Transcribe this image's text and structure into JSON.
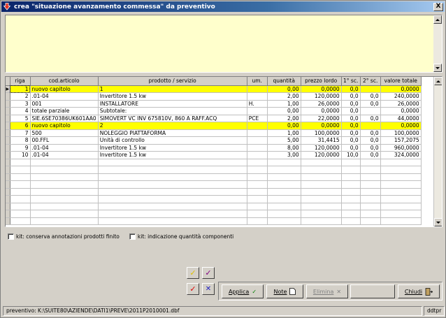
{
  "window": {
    "title": "crea \"situazione avanzamento commessa\" da preventivo",
    "close_label": "X"
  },
  "grid": {
    "columns": [
      "riga",
      "cod.articolo",
      "prodotto / servizio",
      "um.",
      "quantità",
      "prezzo lordo",
      "1° sc.",
      "2° sc.",
      "valore totale"
    ],
    "rows": [
      {
        "riga": "1",
        "cod": "nuovo capitolo",
        "prod": "1",
        "um": "",
        "qta": "0,00",
        "prezzo": "0,0000",
        "sc1": "0,0",
        "sc2": "",
        "tot": "0,0000",
        "highlight": true,
        "current": true
      },
      {
        "riga": "2",
        "cod": ".01-04",
        "prod": "Invertitore 1.5 kw",
        "um": "",
        "qta": "2,00",
        "prezzo": "120,0000",
        "sc1": "0,0",
        "sc2": "0,0",
        "tot": "240,0000",
        "highlight": false
      },
      {
        "riga": "3",
        "cod": "001",
        "prod": "INSTALLATORE",
        "um": "H.",
        "qta": "1,00",
        "prezzo": "26,0000",
        "sc1": "0,0",
        "sc2": "0,0",
        "tot": "26,0000",
        "highlight": false
      },
      {
        "riga": "4",
        "cod": "totale parziale",
        "prod": "Subtotale:",
        "um": "",
        "qta": "0,00",
        "prezzo": "0,0000",
        "sc1": "0,0",
        "sc2": "",
        "tot": "0,0000",
        "highlight": false
      },
      {
        "riga": "5",
        "cod": "SIE.6SE70386UK601AA0",
        "prod": "SIMOVERT VC INV 675810V, 860 A  RAFF.ACQ",
        "um": "PCE",
        "qta": "2,00",
        "prezzo": "22,0000",
        "sc1": "0,0",
        "sc2": "0,0",
        "tot": "44,0000",
        "highlight": false
      },
      {
        "riga": "6",
        "cod": "nuovo capitolo",
        "prod": "2",
        "um": "",
        "qta": "0,00",
        "prezzo": "0,0000",
        "sc1": "0,0",
        "sc2": "",
        "tot": "0,0000",
        "highlight": true
      },
      {
        "riga": "7",
        "cod": "500",
        "prod": "NOLEGGIO PIATTAFORMA",
        "um": "",
        "qta": "1,00",
        "prezzo": "100,0000",
        "sc1": "0,0",
        "sc2": "0,0",
        "tot": "100,0000",
        "highlight": false
      },
      {
        "riga": "8",
        "cod": "00.FFL",
        "prod": "Unità di controllo",
        "um": "",
        "qta": "5,00",
        "prezzo": "31,4415",
        "sc1": "0,0",
        "sc2": "0,0",
        "tot": "157,2075",
        "highlight": false
      },
      {
        "riga": "9",
        "cod": ".01-04",
        "prod": "Invertitore 1.5 kw",
        "um": "",
        "qta": "8,00",
        "prezzo": "120,0000",
        "sc1": "0,0",
        "sc2": "0,0",
        "tot": "960,0000",
        "highlight": false
      },
      {
        "riga": "10",
        "cod": ".01-04",
        "prod": "Invertitore 1.5 kw",
        "um": "",
        "qta": "3,00",
        "prezzo": "120,0000",
        "sc1": "10,0",
        "sc2": "0,0",
        "tot": "324,0000",
        "highlight": false
      }
    ],
    "empty_rows": 9
  },
  "options": {
    "kit_annotazioni": "kit: conserva annotazioni prodotti finito",
    "kit_quantita": "kit: indicazione quantità componenti"
  },
  "buttons": {
    "applica": "Applica",
    "note": "Note",
    "elimina": "Elimina",
    "chiudi": "Chiudi"
  },
  "status": {
    "path": "preventivo: K:\\SUITE80\\AZIENDE\\DATI1\\PREVE\\2011P2010001.dbf",
    "user": "ddtpr"
  },
  "colors": {
    "highlight_row": "#ffff00",
    "memo_bg": "#ffffcc",
    "title_bar": "#0a246a"
  }
}
